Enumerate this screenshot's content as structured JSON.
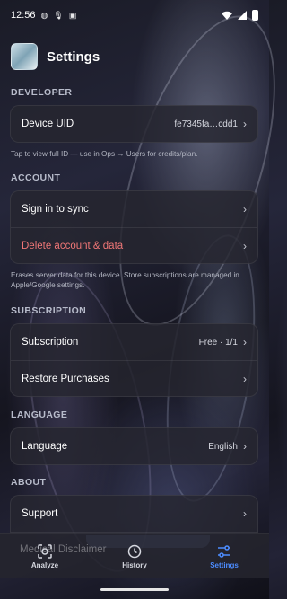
{
  "status_bar": {
    "time": "12:56"
  },
  "header": {
    "title": "Settings"
  },
  "sections": {
    "developer": {
      "label": "DEVELOPER",
      "device_uid_label": "Device UID",
      "device_uid_value": "fe7345fa…cdd1",
      "note": "Tap to view full ID — use in Ops → Users for credits/plan."
    },
    "account": {
      "label": "ACCOUNT",
      "sign_in_label": "Sign in to sync",
      "delete_label": "Delete account & data",
      "note": "Erases server data for this device. Store subscriptions are managed in Apple/Google settings."
    },
    "subscription": {
      "label": "SUBSCRIPTION",
      "subscription_label": "Subscription",
      "subscription_value": "Free · 1/1",
      "restore_label": "Restore Purchases"
    },
    "language": {
      "label": "LANGUAGE",
      "language_label": "Language",
      "language_value": "English"
    },
    "about": {
      "label": "ABOUT",
      "support_label": "Support",
      "medical_peek": "Medical Disclaimer"
    }
  },
  "chevron": "›",
  "bottom_nav": {
    "analyze": "Analyze",
    "history": "History",
    "settings": "Settings",
    "active_color": "#4c8cff"
  },
  "colors": {
    "danger": "#ef7676",
    "accent": "#4c8cff"
  }
}
